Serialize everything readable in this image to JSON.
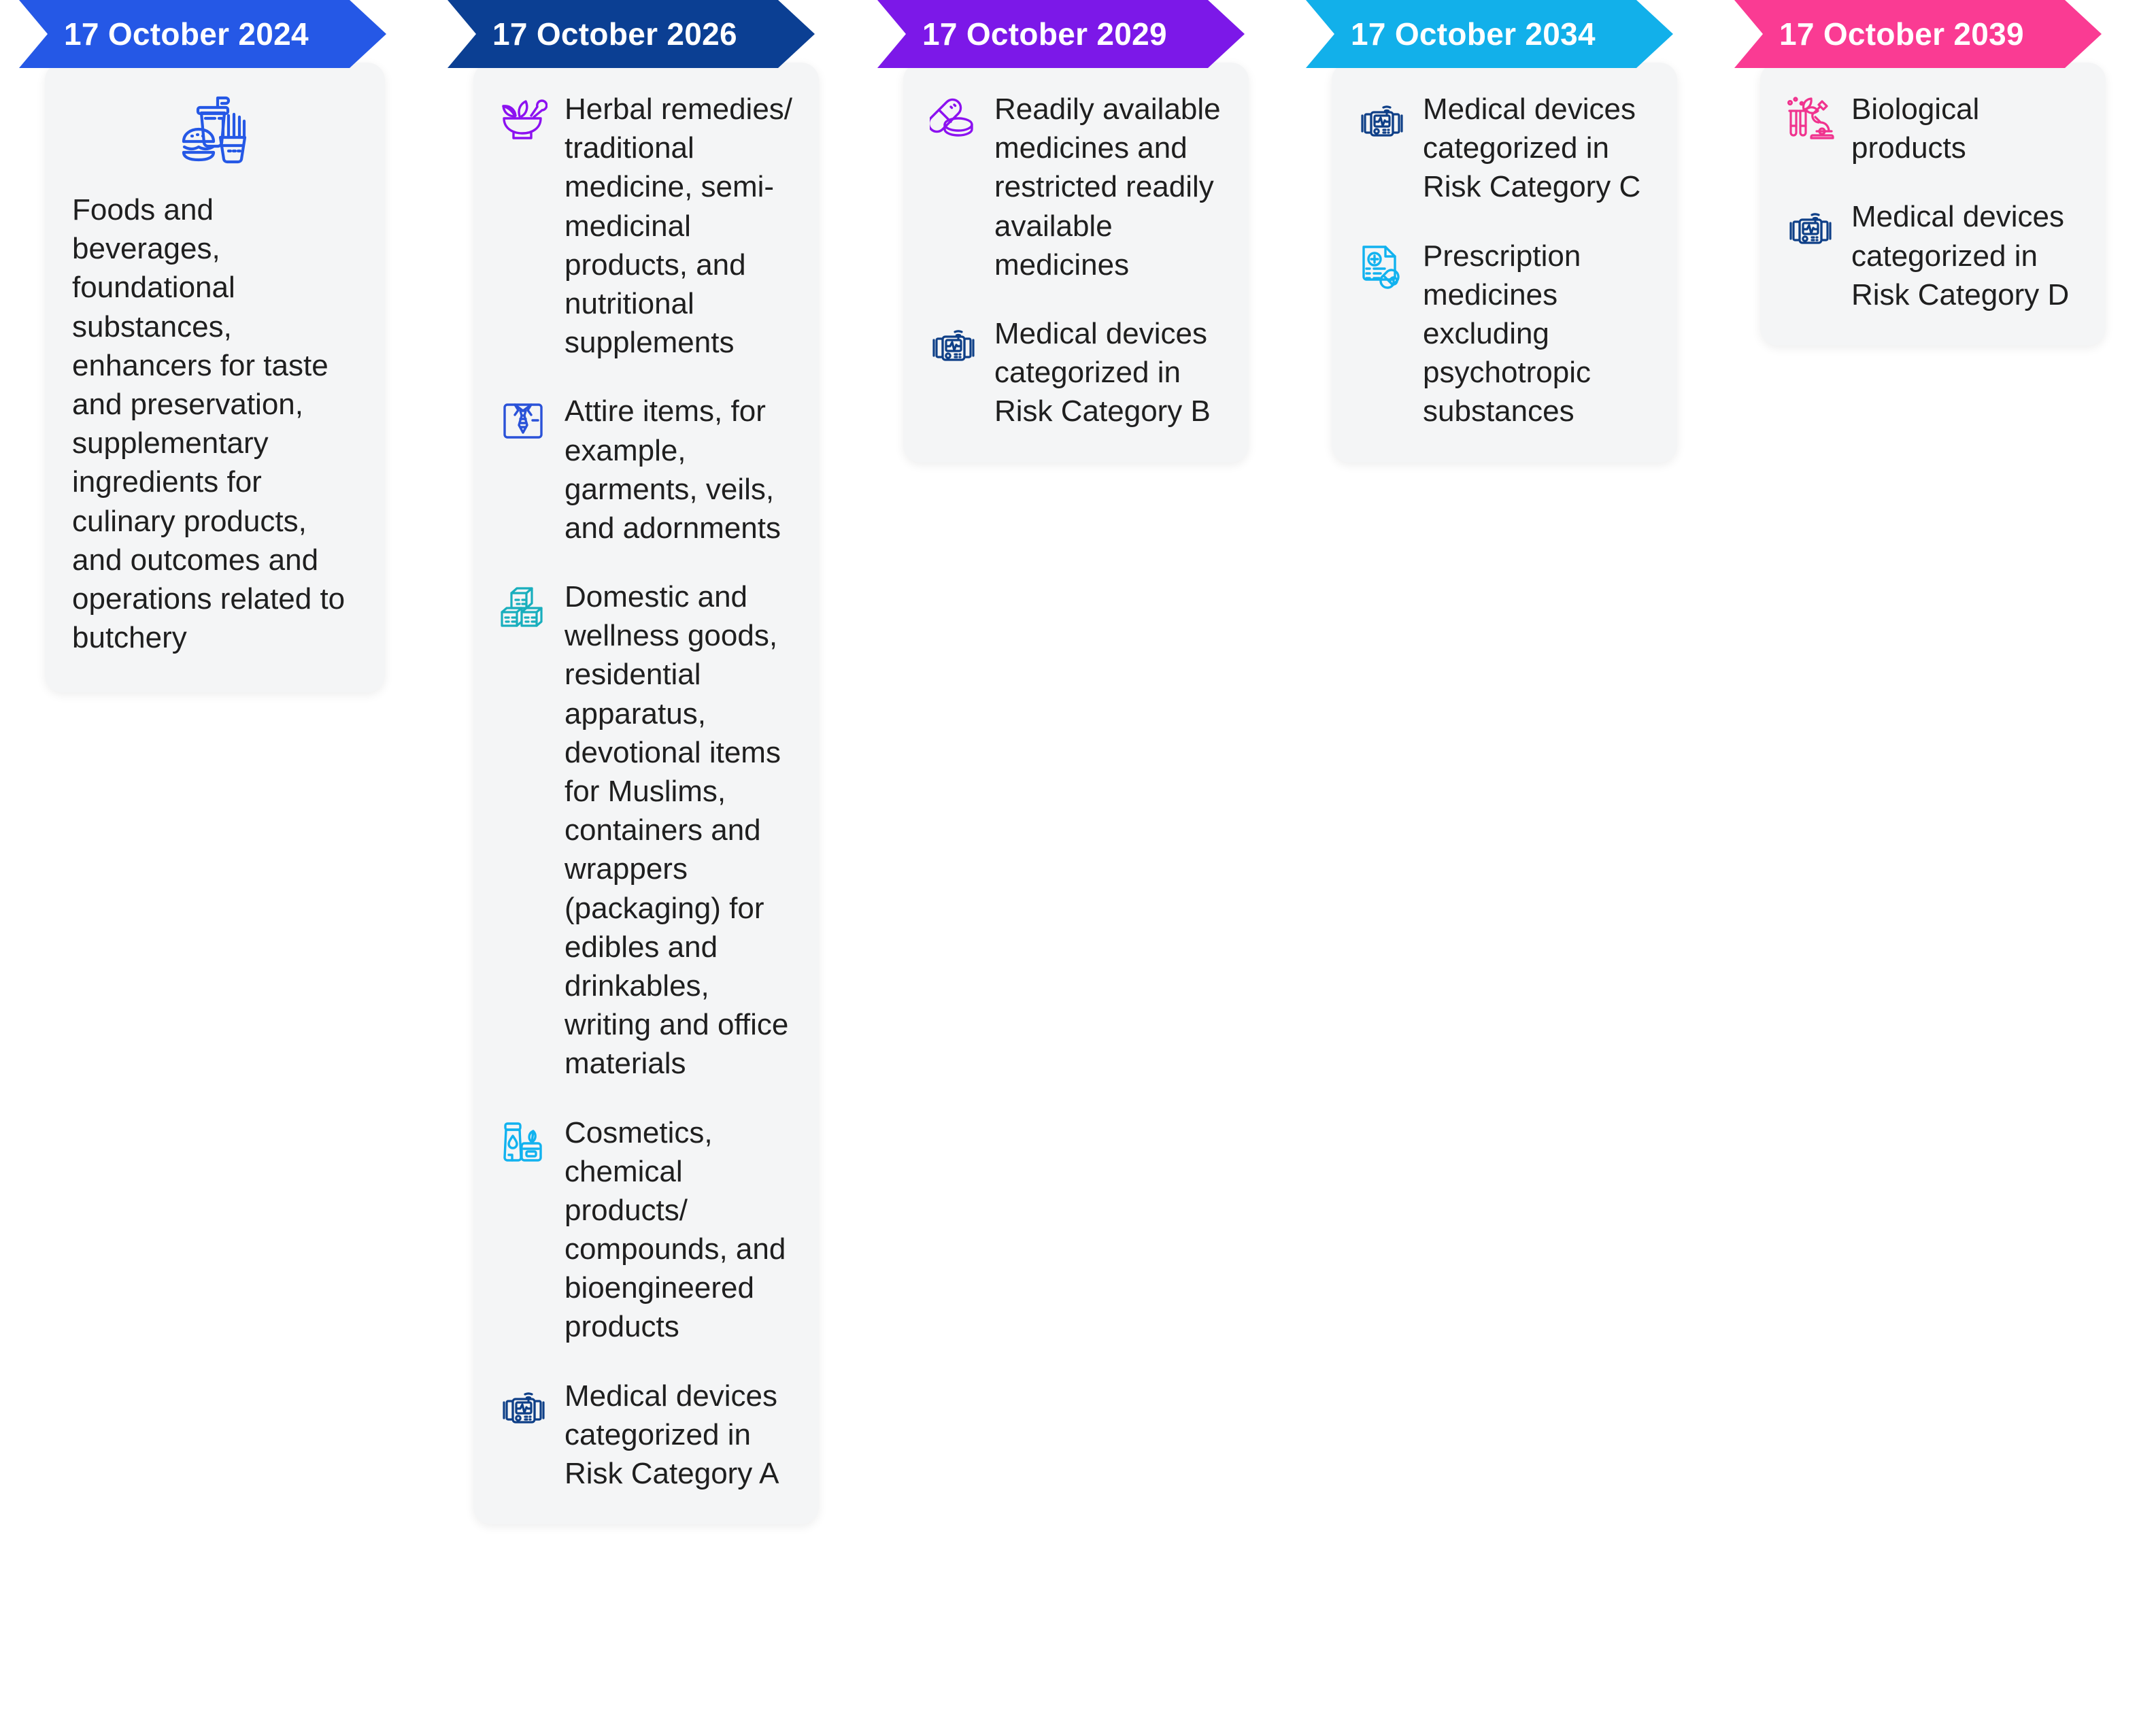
{
  "colors": {
    "banner_2024": "#2558e6",
    "banner_2026": "#0b3f93",
    "banner_2029": "#7c18e8",
    "banner_2034": "#12b0ea",
    "banner_2039": "#fa3b93",
    "card_bg": "#f4f5f6",
    "text": "#1f1f1f",
    "icon_food": "#2558e6",
    "icon_mortar": "#8c11f0",
    "icon_shirt": "#2a52d8",
    "icon_boxes": "#18aebd",
    "icon_cosmetics": "#11b2ef",
    "icon_device": "#0e3f87",
    "icon_pills": "#8c11f0",
    "icon_prescription": "#11b2ef",
    "icon_biological": "#f0338e"
  },
  "columns": [
    {
      "date": "17 October 2024",
      "layout": "centered",
      "top_icon": "fast-food-icon",
      "body": "Foods and beverages, foundational substances, enhancers for taste and preservation, supplementary ingredients for culinary products, and outcomes and operations related to butchery",
      "items": []
    },
    {
      "date": "17 October 2026",
      "layout": "list",
      "items": [
        {
          "icon": "mortar-pestle-icon",
          "text": "Herbal remedies/ traditional medicine, semi-medicinal products, and nutritional supplements"
        },
        {
          "icon": "shirt-tie-icon",
          "text": "Attire items, for example, garments, veils, and adornments"
        },
        {
          "icon": "stacked-boxes-icon",
          "text": "Domestic and wellness goods, residential apparatus, devotional items for Muslims, containers and wrappers (packaging) for edibles and drinkables, writing and office materials"
        },
        {
          "icon": "cosmetics-icon",
          "text": "Cosmetics, chemical products/ compounds, and bioengineered products"
        },
        {
          "icon": "medical-device-icon",
          "text": "Medical devices categorized in Risk Category A"
        }
      ]
    },
    {
      "date": "17 October 2029",
      "layout": "list",
      "items": [
        {
          "icon": "pills-icon",
          "text": "Readily available medicines and restricted readily available medicines"
        },
        {
          "icon": "medical-device-icon",
          "text": "Medical devices categorized in Risk Category B"
        }
      ]
    },
    {
      "date": "17 October 2034",
      "layout": "list",
      "items": [
        {
          "icon": "medical-device-icon",
          "text": "Medical devices categorized in Risk Category C"
        },
        {
          "icon": "prescription-icon",
          "text": "Prescription medicines excluding psychotropic substances"
        }
      ]
    },
    {
      "date": "17 October 2039",
      "layout": "list",
      "items": [
        {
          "icon": "biological-products-icon",
          "text": "Biological products"
        },
        {
          "icon": "medical-device-icon",
          "text": "Medical devices categorized in Risk Category D"
        }
      ]
    }
  ]
}
